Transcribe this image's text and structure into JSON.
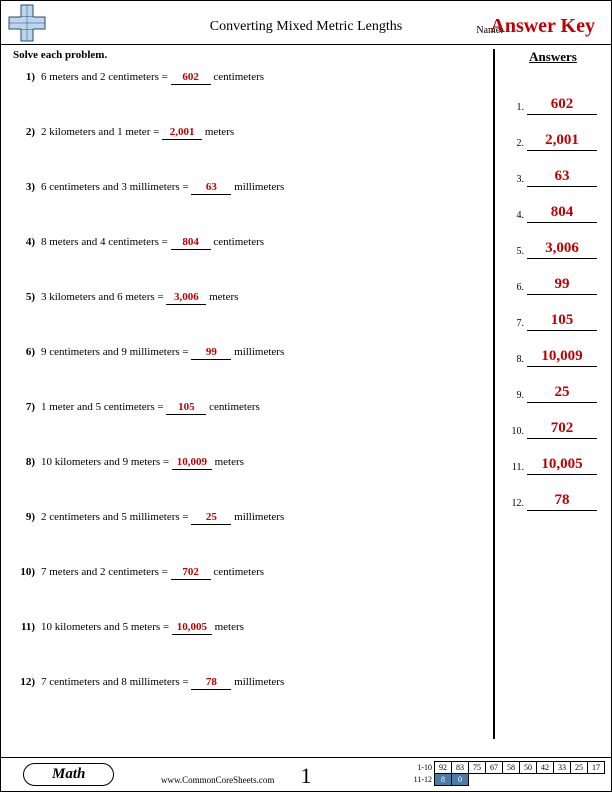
{
  "header": {
    "title": "Converting Mixed Metric Lengths",
    "name_label": "Name:",
    "answer_key": "Answer Key"
  },
  "instruction": "Solve each problem.",
  "answers_heading": "Answers",
  "problems": [
    {
      "num": "1)",
      "before": "6 meters and 2 centimeters = ",
      "ans": "602",
      "after": " centimeters"
    },
    {
      "num": "2)",
      "before": "2 kilometers and 1 meter = ",
      "ans": "2,001",
      "after": " meters"
    },
    {
      "num": "3)",
      "before": "6 centimeters and 3 millimeters = ",
      "ans": "63",
      "after": " millimeters"
    },
    {
      "num": "4)",
      "before": "8 meters and 4 centimeters = ",
      "ans": "804",
      "after": " centimeters"
    },
    {
      "num": "5)",
      "before": "3 kilometers and 6 meters = ",
      "ans": "3,006",
      "after": " meters"
    },
    {
      "num": "6)",
      "before": "9 centimeters and 9 millimeters = ",
      "ans": "99",
      "after": " millimeters"
    },
    {
      "num": "7)",
      "before": "1 meter and 5 centimeters = ",
      "ans": "105",
      "after": " centimeters"
    },
    {
      "num": "8)",
      "before": "10 kilometers and 9 meters = ",
      "ans": "10,009",
      "after": " meters"
    },
    {
      "num": "9)",
      "before": "2 centimeters and 5 millimeters = ",
      "ans": "25",
      "after": " millimeters"
    },
    {
      "num": "10)",
      "before": "7 meters and 2 centimeters = ",
      "ans": "702",
      "after": " centimeters"
    },
    {
      "num": "11)",
      "before": "10 kilometers and 5 meters = ",
      "ans": "10,005",
      "after": " meters"
    },
    {
      "num": "12)",
      "before": "7 centimeters and 8 millimeters = ",
      "ans": "78",
      "after": " millimeters"
    }
  ],
  "answers": [
    "602",
    "2,001",
    "63",
    "804",
    "3,006",
    "99",
    "105",
    "10,009",
    "25",
    "702",
    "10,005",
    "78"
  ],
  "footer": {
    "subject": "Math",
    "site": "www.CommonCoreSheets.com",
    "page": "1",
    "grid": {
      "row1_label": "1-10",
      "row1": [
        "92",
        "83",
        "75",
        "67",
        "58",
        "50",
        "42",
        "33",
        "25",
        "17"
      ],
      "row2_label": "11-12",
      "row2": [
        "8",
        "0"
      ]
    }
  }
}
